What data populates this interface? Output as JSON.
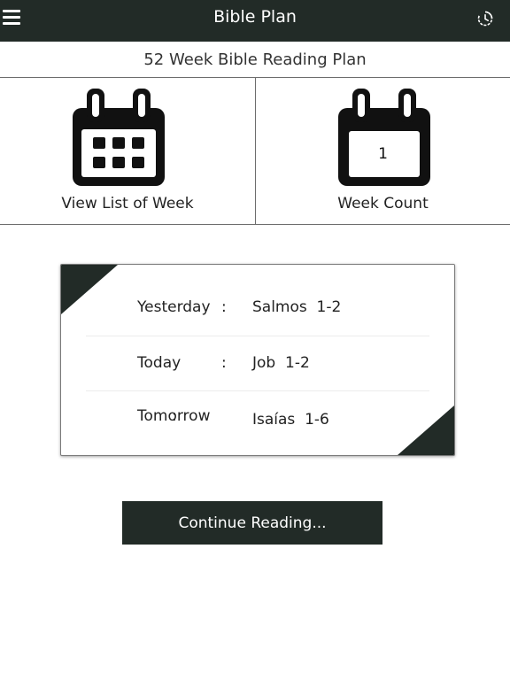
{
  "header": {
    "title": "Bible Plan",
    "menu_icon": "hamburger-menu-icon",
    "history_icon": "history-clock-icon",
    "background_color": "#222b27"
  },
  "plan": {
    "title": "52 Week Bible Reading Plan"
  },
  "tiles": [
    {
      "label": "View List of Week",
      "icon": "calendar-grid-icon"
    },
    {
      "label": "Week Count",
      "icon": "calendar-number-icon",
      "week_number": "1"
    }
  ],
  "schedule": {
    "rows": [
      {
        "day": "Yesterday",
        "separator": ":",
        "passage": "Salmos  1-2"
      },
      {
        "day": "Today",
        "separator": ":",
        "passage": "Job  1-2"
      },
      {
        "day": "Tomorrow",
        "separator": ":",
        "passage": "Isaías  1-6"
      }
    ]
  },
  "actions": {
    "continue_label": "Continue Reading..."
  }
}
